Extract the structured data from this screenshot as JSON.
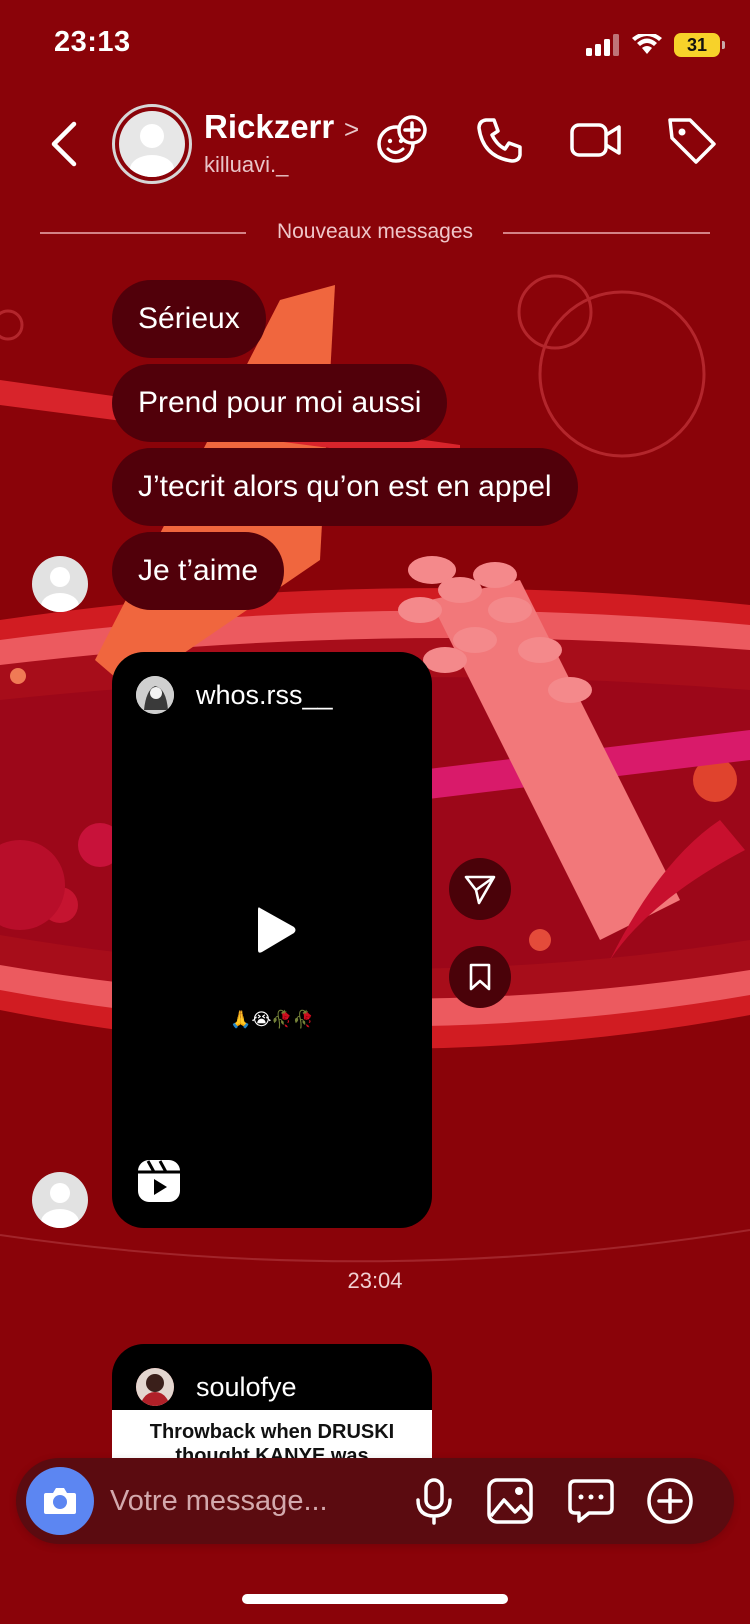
{
  "status_bar": {
    "time": "23:13",
    "battery": "31"
  },
  "header": {
    "name": "Rickzerr",
    "chevron": ">",
    "handle": "killuavi._",
    "icons": [
      "effects-icon",
      "phone-icon",
      "video-icon",
      "tag-icon"
    ]
  },
  "divider": {
    "label": "Nouveaux messages"
  },
  "messages": [
    {
      "text": "Sérieux"
    },
    {
      "text": "Prend pour moi aussi"
    },
    {
      "text": "J’tecrit alors qu’on est en appel"
    },
    {
      "text": "Je t’aime"
    }
  ],
  "reel_card_1": {
    "username": "whos.rss__",
    "caption": "🙏😭🥀🥀"
  },
  "timestamp": "23:04",
  "reel_card_2": {
    "username": "soulofye",
    "caption": "Throwback when DRUSKI thought KANYE was"
  },
  "composer": {
    "placeholder": "Votre message..."
  },
  "colors": {
    "background": "#8a0309",
    "bubble": "#51000a",
    "camera_button": "#5c86f2",
    "battery": "#f7d22a"
  }
}
